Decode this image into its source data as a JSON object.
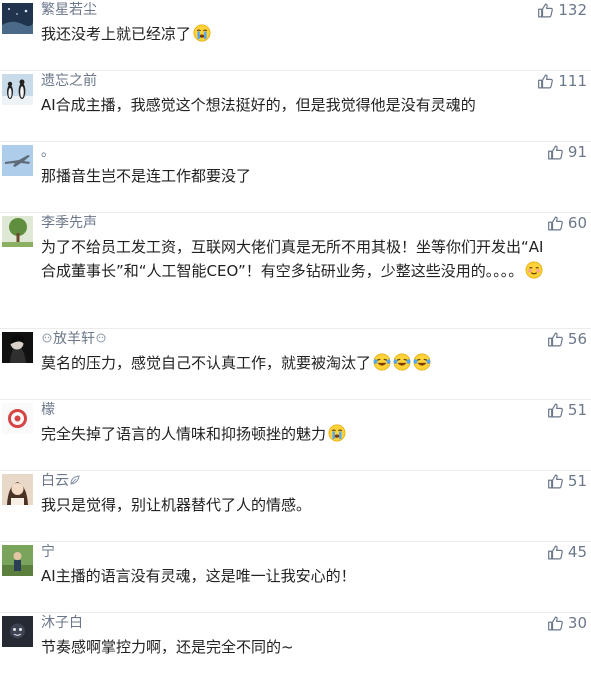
{
  "comments": [
    {
      "username": "繁星若尘",
      "text": "我还没考上就已经凉了",
      "likes": "132",
      "emojis": [
        "crying-face-icon"
      ],
      "avatar": "night-sky-avatar"
    },
    {
      "username": "遗忘之前",
      "text": "AI合成主播，我感觉这个想法挺好的，但是我觉得他是没有灵魂的",
      "likes": "111",
      "emojis": [],
      "avatar": "penguins-avatar"
    },
    {
      "username": "。",
      "text": "那播音生岂不是连工作都要没了",
      "likes": "91",
      "emojis": [],
      "avatar": "jet-avatar"
    },
    {
      "username": "李季先声",
      "text": "为了不给员工发工资，互联网大佬们真是无所不用其极！坐等你们开发出“AI合成董事长”和“人工智能CEO”！有空多钻研业务，少整这些没用的。。。。",
      "likes": "60",
      "emojis": [
        "smiling-face-icon"
      ],
      "avatar": "tree-avatar"
    },
    {
      "username": "放羊轩",
      "text": "莫名的压力，感觉自己不认真工作，就要被淘汰了",
      "likes": "56",
      "emojis": [
        "laughing-tears-icon",
        "laughing-tears-icon",
        "laughing-tears-icon"
      ],
      "avatar": "dark-portrait-avatar"
    },
    {
      "username": "檬",
      "text": "完全失掉了语言的人情味和抑扬顿挫的魅力",
      "likes": "51",
      "emojis": [
        "crying-face-icon"
      ],
      "avatar": "red-ring-avatar"
    },
    {
      "username": "白云",
      "text": "我只是觉得，别让机器替代了人的情感。",
      "likes": "51",
      "emojis": [],
      "avatar": "girl-avatar"
    },
    {
      "username": "宁",
      "text": "AI主播的语言没有灵魂，这是唯一让我安心的！",
      "likes": "45",
      "emojis": [],
      "avatar": "outdoor-person-avatar"
    },
    {
      "username": "沐子白",
      "text": "节奏感啊掌控力啊，还是完全不同的~",
      "likes": "30",
      "emojis": [],
      "avatar": "dark-cartoon-avatar"
    }
  ]
}
